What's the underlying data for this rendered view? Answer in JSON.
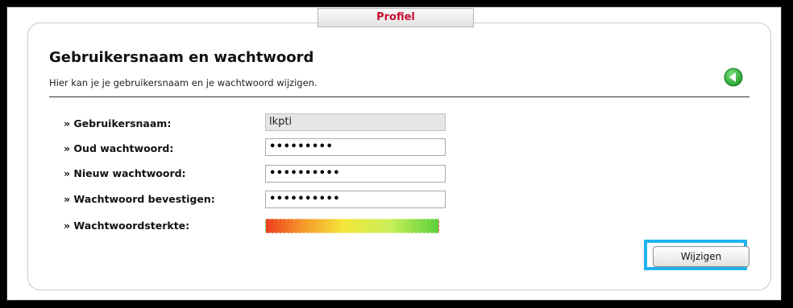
{
  "tab": {
    "label": "Profiel"
  },
  "header": {
    "title": "Gebruikersnaam en wachtwoord",
    "subtitle": "Hier kan je je gebruikersnaam en je wachtwoord wijzigen."
  },
  "icons": {
    "back": "back-arrow-icon"
  },
  "form": {
    "username": {
      "label": "» Gebruikersnaam:",
      "value": "lkpti"
    },
    "old_password": {
      "label": "» Oud wachtwoord:",
      "value": "•••••••••"
    },
    "new_password": {
      "label": "» Nieuw wachtwoord:",
      "value": "••••••••••"
    },
    "confirm_password": {
      "label": "» Wachtwoord bevestigen:",
      "value": "••••••••••"
    },
    "strength": {
      "label": "» Wachtwoordsterkte:"
    },
    "submit_label": "Wijzigen"
  },
  "colors": {
    "tab_text": "#c8102e",
    "highlight": "#1fb3f0",
    "back_icon": "#3cb93c"
  }
}
